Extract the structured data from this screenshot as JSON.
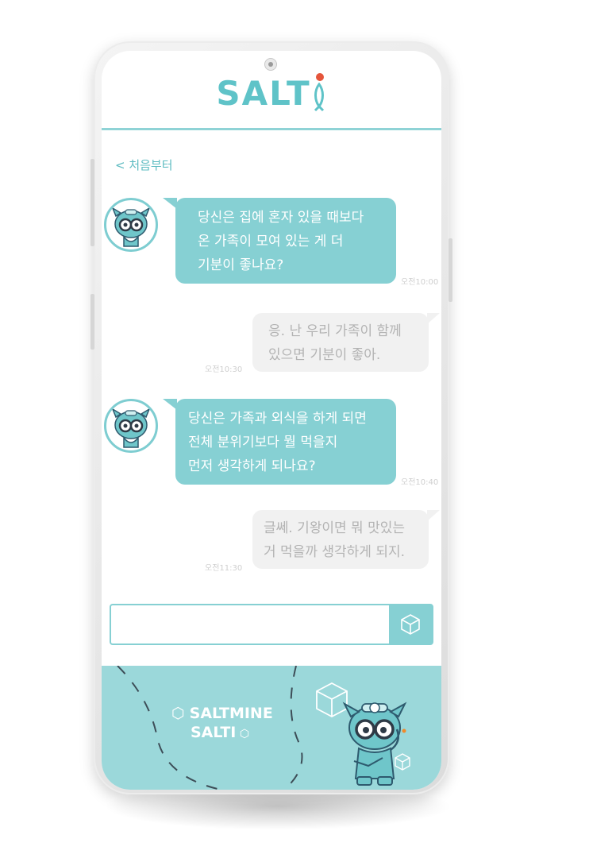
{
  "app": {
    "logo_text": "SALT",
    "back_label": "< 처음부터"
  },
  "messages": [
    {
      "from": "bot",
      "lines": [
        "당신은 집에 혼자 있을 때보다",
        "온 가족이 모여 있는 게 더",
        "기분이 좋나요?"
      ],
      "time": "오전10:00"
    },
    {
      "from": "user",
      "lines": [
        "응. 난 우리 가족이 함께",
        "있으면 기분이 좋아."
      ],
      "time": "오전10:30"
    },
    {
      "from": "bot",
      "lines": [
        "당신은 가족과 외식을 하게 되면",
        "전체 분위기보다 뭘 먹을지",
        "먼저 생각하게 되나요?"
      ],
      "time": "오전10:40"
    },
    {
      "from": "user",
      "lines": [
        "글쎄. 기왕이면 뭐 맛있는",
        "거 먹을까 생각하게 되지."
      ],
      "time": "오전11:30"
    }
  ],
  "composer": {
    "value": "",
    "placeholder": "",
    "send_icon": "salt-cube-icon"
  },
  "footer": {
    "brand_line1": "SALTMINE",
    "brand_line2": "SALTI"
  },
  "colors": {
    "accent": "#86d0d3",
    "logo": "#5fc3c8",
    "logo_dot": "#e5553b",
    "user_bubble": "#f1f1f1",
    "footer_bg": "#9bd8da"
  }
}
